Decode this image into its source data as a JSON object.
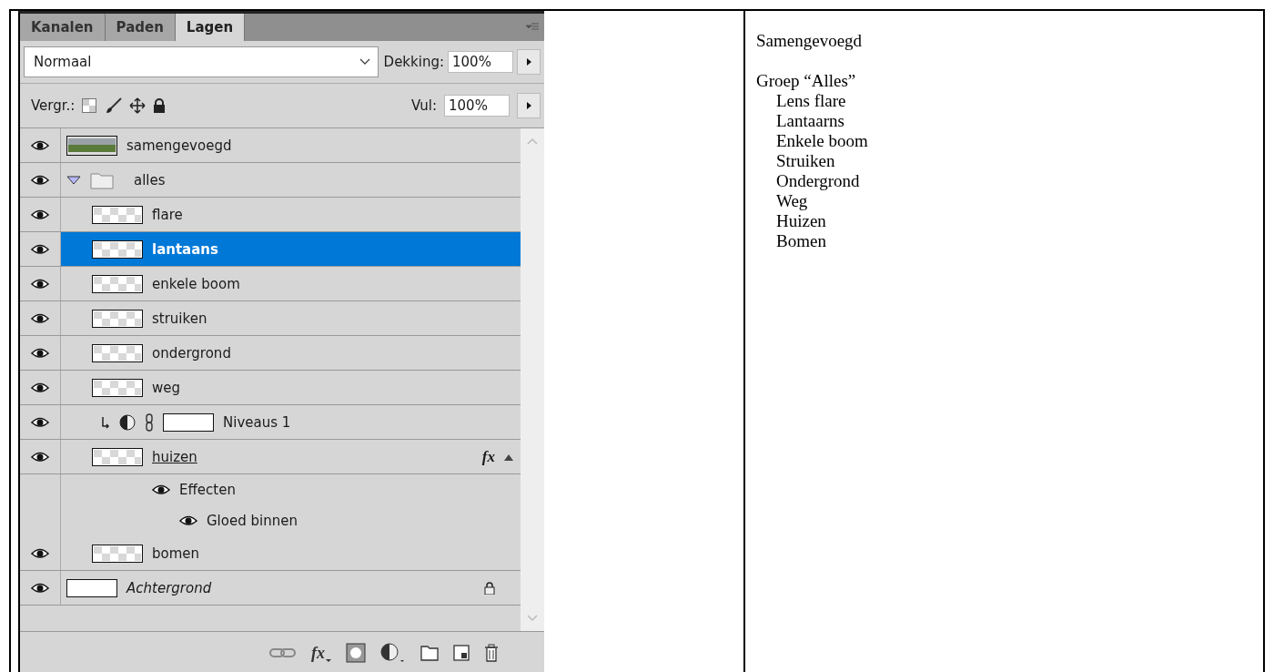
{
  "panel": {
    "tabs": [
      {
        "label": "Kanalen",
        "selected": false
      },
      {
        "label": "Paden",
        "selected": false
      },
      {
        "label": "Lagen",
        "selected": true
      }
    ],
    "blend_mode": "Normaal",
    "opacity": {
      "label": "Dekking:",
      "value": "100%"
    },
    "lock_label": "Vergr.:",
    "fill": {
      "label": "Vul:",
      "value": "100%"
    },
    "footer_fx": "fx",
    "layers": [
      {
        "name": "samengevoegd",
        "kind": "merged",
        "visible": true,
        "selected": false
      },
      {
        "name": "alles",
        "kind": "group",
        "expanded": true,
        "visible": true,
        "selected": false,
        "children": [
          {
            "name": "flare",
            "kind": "layer",
            "visible": true,
            "selected": false
          },
          {
            "name": "lantaans",
            "kind": "layer",
            "visible": true,
            "selected": true
          },
          {
            "name": "enkele boom",
            "kind": "layer",
            "visible": true,
            "selected": false
          },
          {
            "name": "struiken",
            "kind": "layer",
            "visible": true,
            "selected": false
          },
          {
            "name": "ondergrond",
            "kind": "layer",
            "visible": true,
            "selected": false
          },
          {
            "name": "weg",
            "kind": "layer",
            "visible": true,
            "selected": false
          },
          {
            "name": "Niveaus 1",
            "kind": "adjustment",
            "visible": true,
            "selected": false
          },
          {
            "name": "huizen",
            "kind": "layer",
            "fx": "fx",
            "visible": true,
            "selected": false,
            "children": [
              {
                "name": "Effecten",
                "kind": "effects",
                "visible": true,
                "children": [
                  {
                    "name": "Gloed binnen",
                    "kind": "effect",
                    "visible": true
                  }
                ]
              }
            ]
          },
          {
            "name": "bomen",
            "kind": "layer",
            "visible": true,
            "selected": false
          }
        ]
      },
      {
        "name": "Achtergrond",
        "kind": "background",
        "locked": true,
        "visible": true,
        "selected": false
      }
    ]
  },
  "notes": [
    {
      "text": "Samengevoegd"
    },
    {
      "text": "Groep “Alles”",
      "children": [
        {
          "text": "Lens flare"
        },
        {
          "text": "Lantaarns"
        },
        {
          "text": "Enkele boom"
        },
        {
          "text": "Struiken"
        },
        {
          "text": "Ondergrond"
        },
        {
          "text": "Weg"
        },
        {
          "text": "Huizen"
        },
        {
          "text": "Bomen"
        }
      ]
    }
  ]
}
